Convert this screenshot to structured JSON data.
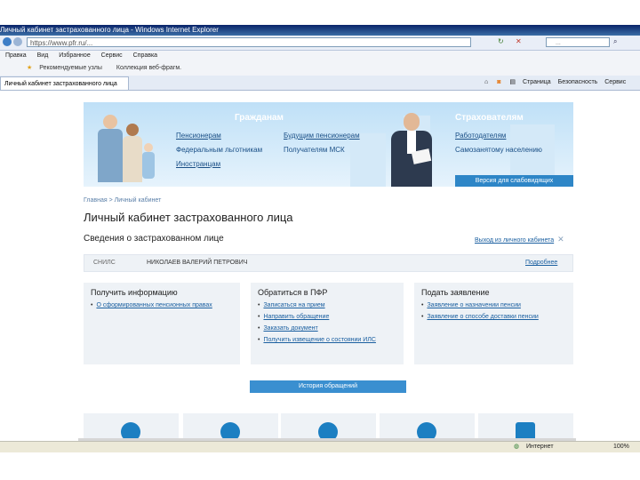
{
  "browser": {
    "title": "Личный кабинет застрахованного лица - Windows Internet Explorer",
    "url": "https://www.pfr.ru/...",
    "search_placeholder": "...",
    "menu": [
      "Правка",
      "Вид",
      "Избранное",
      "Сервис",
      "Справка"
    ],
    "favorites": [
      "Рекомендуемые узлы",
      "Коллекция веб-фрагм."
    ],
    "tab_label": "Личный кабинет застрахованного лица",
    "commands": [
      "Страница",
      "Безопасность",
      "Сервис"
    ]
  },
  "banner": {
    "citizens_title": "Гражданам",
    "citizens_links": [
      "Пенсионерам",
      "Будущим пенсионерам",
      "Федеральным льготникам",
      "Получателям МСК",
      "Иностранцам"
    ],
    "insurers_title": "Страхователям",
    "insurers_links": [
      "Работодателям",
      "Самозанятому населению"
    ],
    "accessibility": "Версия для слабовидящих"
  },
  "breadcrumb": "Главная > Личный кабинет",
  "page_title": "Личный кабинет застрахованного лица",
  "section_title": "Сведения о застрахованном лице",
  "exit_link": "Выход из личного кабинета",
  "person": {
    "snils_label": "СНИЛС",
    "name": "НИКОЛАЕВ ВАЛЕРИЙ ПЕТРОВИЧ",
    "details_link": "Подробнее"
  },
  "cards": [
    {
      "title": "Получить информацию",
      "items": [
        "О сформированных пенсионных правах"
      ]
    },
    {
      "title": "Обратиться в ПФР",
      "items": [
        "Записаться на прием",
        "Направить обращение",
        "Заказать документ",
        "Получить извещение о состоянии ИЛС"
      ]
    },
    {
      "title": "Подать заявление",
      "items": [
        "Заявление о назначении пенсии",
        "Заявление о способе доставки пенсии"
      ]
    }
  ],
  "history_button": "История обращений",
  "status": {
    "zone": "Интернет",
    "zoom": "100%"
  },
  "colors": {
    "accent": "#1c7fc2",
    "panel": "#eef2f6"
  }
}
